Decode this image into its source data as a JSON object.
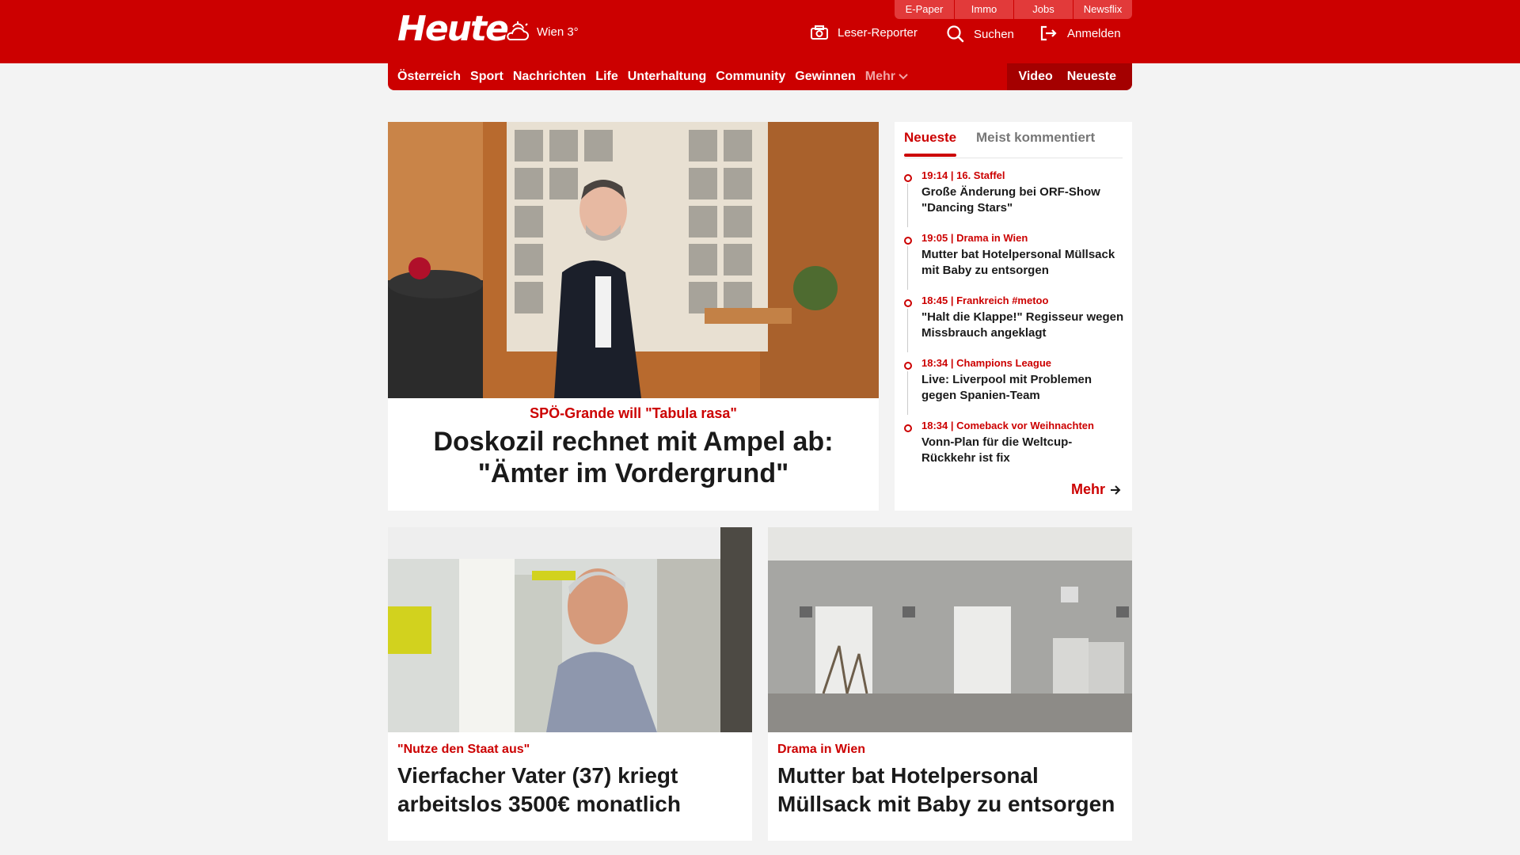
{
  "header": {
    "top_links": [
      "E-Paper",
      "Immo",
      "Jobs",
      "Newsflix"
    ],
    "logo": "Heute",
    "weather": "Wien 3°",
    "actions": {
      "reporter": "Leser-Reporter",
      "search": "Suchen",
      "login": "Anmelden"
    }
  },
  "nav": {
    "items": [
      "Österreich",
      "Sport",
      "Nachrichten",
      "Life",
      "Unterhaltung",
      "Community",
      "Gewinnen"
    ],
    "more": "Mehr",
    "right": [
      "Video",
      "Neueste"
    ]
  },
  "hero": {
    "kicker": "SPÖ-Grande will \"Tabula rasa\"",
    "title": "Doskozil rechnet mit Ampel ab: \"Ämter im Vordergrund\""
  },
  "sidebar": {
    "tabs": [
      "Neueste",
      "Meist kommentiert"
    ],
    "items": [
      {
        "meta": "19:14 | 16. Staffel",
        "title": "Große Änderung bei ORF-Show \"Dancing Stars\""
      },
      {
        "meta": "19:05 | Drama in Wien",
        "title": "Mutter bat Hotelpersonal Müllsack mit Baby zu entsorgen"
      },
      {
        "meta": "18:45 | Frankreich #metoo",
        "title": "\"Halt die Klappe!\" Regisseur wegen Missbrauch angeklagt"
      },
      {
        "meta": "18:34 | Champions League",
        "title": "Live: Liverpool mit Problemen gegen Spanien-Team"
      },
      {
        "meta": "18:34 | Comeback vor Weihnachten",
        "title": "Vonn-Plan für die Weltcup-Rückkehr ist fix"
      }
    ],
    "more": "Mehr"
  },
  "cards": [
    {
      "kicker": "\"Nutze den Staat aus\"",
      "title": "Vierfacher Vater (37) kriegt arbeitslos 3500€ monatlich"
    },
    {
      "kicker": "Drama in Wien",
      "title": "Mutter bat Hotelpersonal Müllsack mit Baby zu entsorgen"
    }
  ],
  "colors": {
    "brand": "#cc0000",
    "nav_dark": "#a40000"
  }
}
